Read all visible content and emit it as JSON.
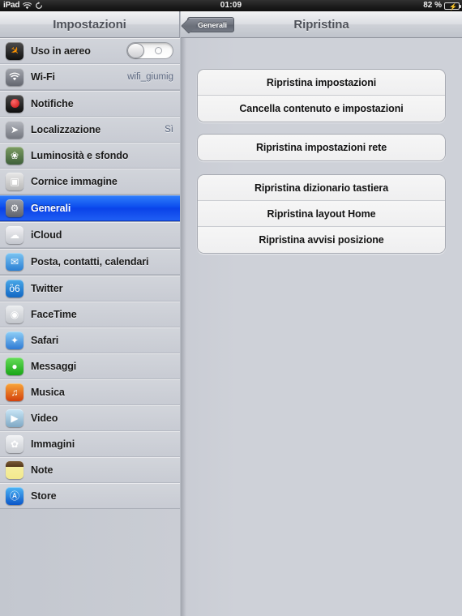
{
  "statusbar": {
    "device": "iPad",
    "wifi_icon": "wifi-icon",
    "sync_icon": "sync-icon",
    "time": "01:09",
    "battery_percent": "82 %",
    "battery_icon": "battery-charging-icon"
  },
  "sidebar": {
    "title": "Impostazioni",
    "items": [
      {
        "label": "Uso in aereo",
        "icon": "airplane-icon",
        "value": "",
        "control": "toggle",
        "toggle_on": false,
        "selected": false
      },
      {
        "label": "Wi-Fi",
        "icon": "wifi-icon",
        "value": "wifi_giumig",
        "control": "value",
        "selected": false
      },
      {
        "label": "Notifiche",
        "icon": "notifications-icon",
        "value": "",
        "control": "none",
        "selected": false
      },
      {
        "label": "Localizzazione",
        "icon": "location-arrow-icon",
        "value": "Sì",
        "control": "value",
        "selected": false
      },
      {
        "label": "Luminosità e sfondo",
        "icon": "brightness-wallpaper-icon",
        "value": "",
        "control": "none",
        "selected": false
      },
      {
        "label": "Cornice immagine",
        "icon": "picture-frame-icon",
        "value": "",
        "control": "none",
        "selected": false
      },
      {
        "label": "Generali",
        "icon": "gears-icon",
        "value": "",
        "control": "none",
        "selected": true
      },
      {
        "label": "iCloud",
        "icon": "icloud-icon",
        "value": "",
        "control": "none",
        "selected": false
      },
      {
        "label": "Posta, contatti, calendari",
        "icon": "mail-icon",
        "value": "",
        "control": "none",
        "selected": false
      },
      {
        "label": "Twitter",
        "icon": "twitter-bird-icon",
        "value": "",
        "control": "none",
        "selected": false
      },
      {
        "label": "FaceTime",
        "icon": "facetime-camera-icon",
        "value": "",
        "control": "none",
        "selected": false
      },
      {
        "label": "Safari",
        "icon": "safari-compass-icon",
        "value": "",
        "control": "none",
        "selected": false
      },
      {
        "label": "Messaggi",
        "icon": "messages-bubble-icon",
        "value": "",
        "control": "none",
        "selected": false
      },
      {
        "label": "Musica",
        "icon": "music-note-icon",
        "value": "",
        "control": "none",
        "selected": false
      },
      {
        "label": "Video",
        "icon": "video-clapper-icon",
        "value": "",
        "control": "none",
        "selected": false
      },
      {
        "label": "Immagini",
        "icon": "photos-flower-icon",
        "value": "",
        "control": "none",
        "selected": false
      },
      {
        "label": "Note",
        "icon": "notes-pad-icon",
        "value": "",
        "control": "none",
        "selected": false
      },
      {
        "label": "Store",
        "icon": "app-store-icon",
        "value": "",
        "control": "none",
        "selected": false
      }
    ]
  },
  "detail": {
    "back_button": "Generali",
    "title": "Ripristina",
    "groups": [
      {
        "rows": [
          {
            "label": "Ripristina impostazioni"
          },
          {
            "label": "Cancella contenuto e impostazioni"
          }
        ]
      },
      {
        "rows": [
          {
            "label": "Ripristina impostazioni rete"
          }
        ]
      },
      {
        "rows": [
          {
            "label": "Ripristina dizionario tastiera"
          },
          {
            "label": "Ripristina layout Home"
          },
          {
            "label": "Ripristina avvisi posizione"
          }
        ]
      }
    ]
  },
  "colors": {
    "selection_blue": "#0a49ed",
    "value_text": "#5c6880",
    "panel_gray": "#ced1d8"
  }
}
